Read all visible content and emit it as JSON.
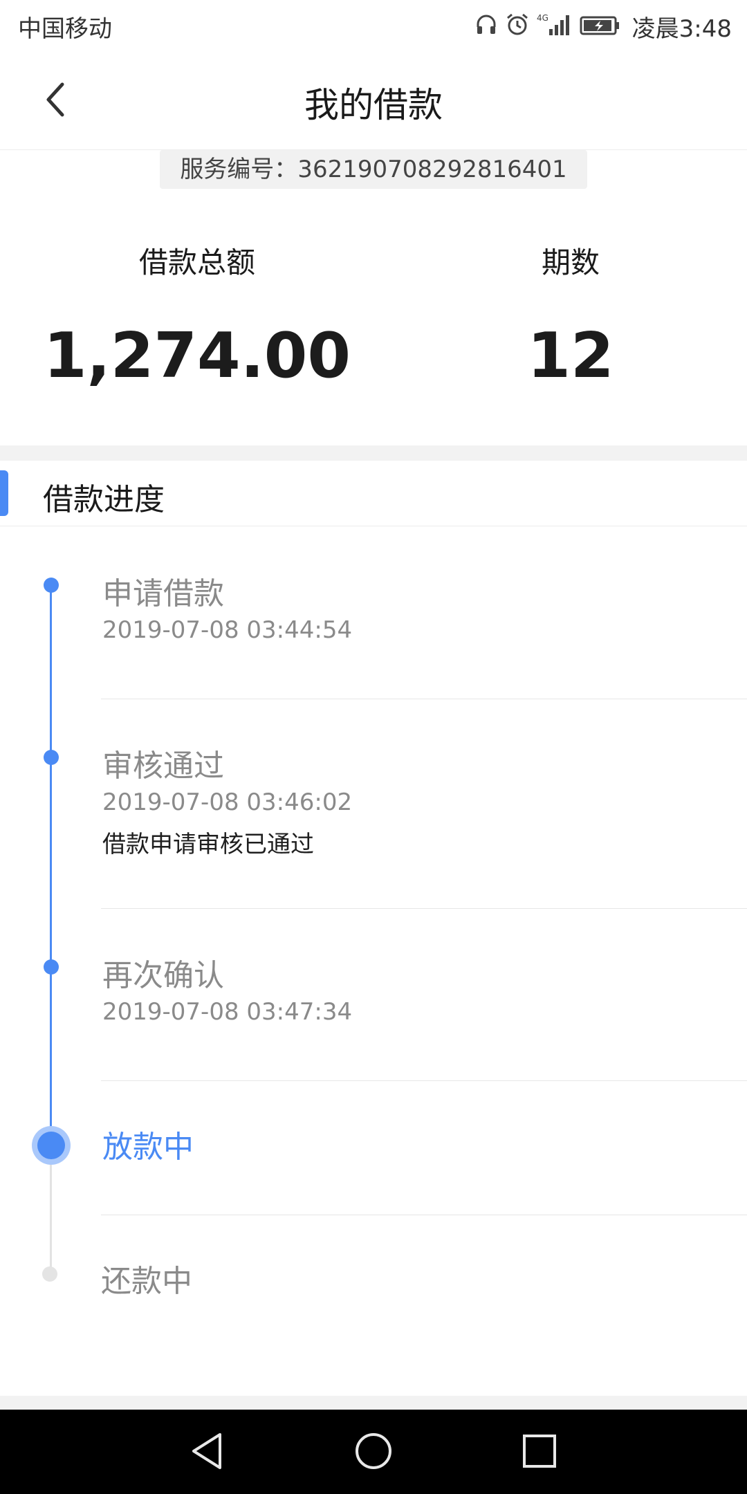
{
  "status_bar": {
    "carrier": "中国移动",
    "network": "4G",
    "time": "凌晨3:48",
    "icons": [
      "headset-icon",
      "alarm-icon",
      "signal-icon",
      "battery-charging-icon"
    ]
  },
  "header": {
    "title": "我的借款",
    "back_icon": "chevron-left-icon"
  },
  "service": {
    "label": "服务编号：362190708292816401"
  },
  "summary": {
    "total_label": "借款总额",
    "total_value": "1,274.00",
    "periods_label": "期数",
    "periods_value": "12"
  },
  "progress": {
    "title": "借款进度",
    "steps": [
      {
        "title": "申请借款",
        "time": "2019-07-08 03:44:54",
        "note": "",
        "state": "done"
      },
      {
        "title": "审核通过",
        "time": "2019-07-08 03:46:02",
        "note": "借款申请审核已通过",
        "state": "done"
      },
      {
        "title": "再次确认",
        "time": "2019-07-08 03:47:34",
        "note": "",
        "state": "done"
      },
      {
        "title": "放款中",
        "time": "",
        "note": "",
        "state": "current"
      },
      {
        "title": "还款中",
        "time": "",
        "note": "",
        "state": "pending"
      }
    ]
  },
  "colors": {
    "accent": "#4a8af4",
    "accent_light": "#a9c8fb",
    "pending": "#e4e4e4"
  },
  "system_nav": {
    "icons": [
      "back-triangle-icon",
      "home-circle-icon",
      "recents-square-icon"
    ]
  }
}
